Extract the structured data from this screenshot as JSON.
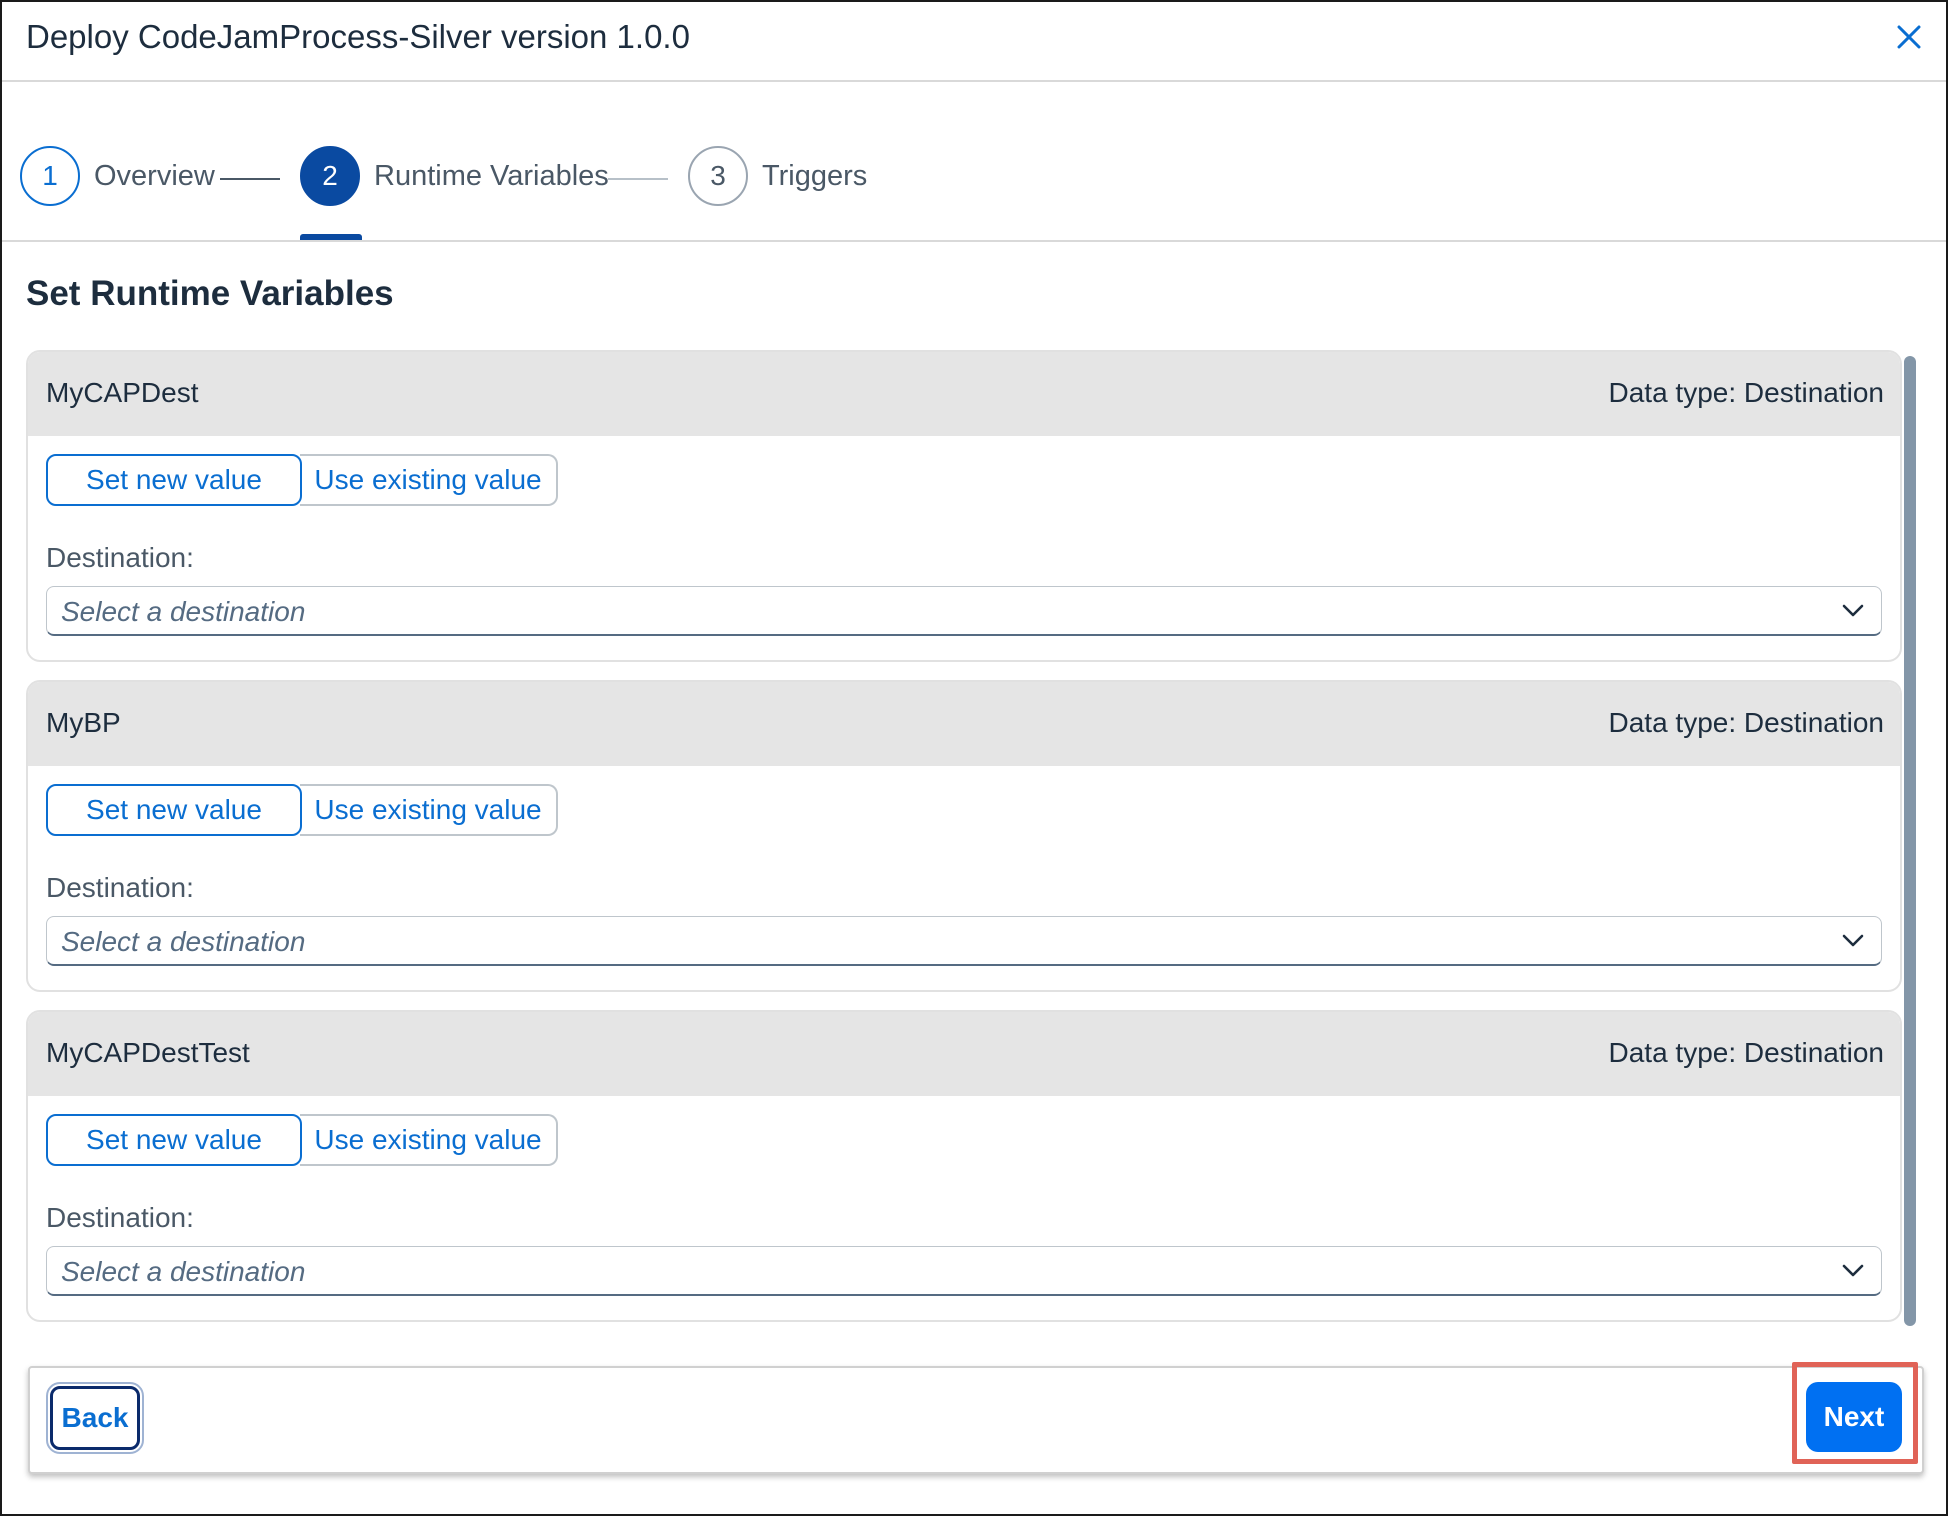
{
  "dialog": {
    "title": "Deploy CodeJamProcess-Silver version 1.0.0",
    "close_icon": "close-icon"
  },
  "wizard": {
    "steps": [
      {
        "number": "1",
        "label": "Overview",
        "state": "completed"
      },
      {
        "number": "2",
        "label": "Runtime Variables",
        "state": "active"
      },
      {
        "number": "3",
        "label": "Triggers",
        "state": "upcoming"
      }
    ]
  },
  "content": {
    "section_title": "Set Runtime Variables",
    "variables": [
      {
        "name": "MyCAPDest",
        "data_type": "Data type: Destination",
        "option_selected": "Set new value",
        "option_other": "Use existing value",
        "field_label": "Destination:",
        "select_placeholder": "Select a destination"
      },
      {
        "name": "MyBP",
        "data_type": "Data type: Destination",
        "option_selected": "Set new value",
        "option_other": "Use existing value",
        "field_label": "Destination:",
        "select_placeholder": "Select a destination"
      },
      {
        "name": "MyCAPDestTest",
        "data_type": "Data type: Destination",
        "option_selected": "Set new value",
        "option_other": "Use existing value",
        "field_label": "Destination:",
        "select_placeholder": "Select a destination"
      }
    ]
  },
  "footer": {
    "back_label": "Back",
    "next_label": "Next"
  },
  "colors": {
    "accent": "#0a6ed1",
    "active_step": "#0a4aa1",
    "primary_button": "#0070f2",
    "highlight": "#e06357",
    "panel_header": "#e5e5e5"
  }
}
